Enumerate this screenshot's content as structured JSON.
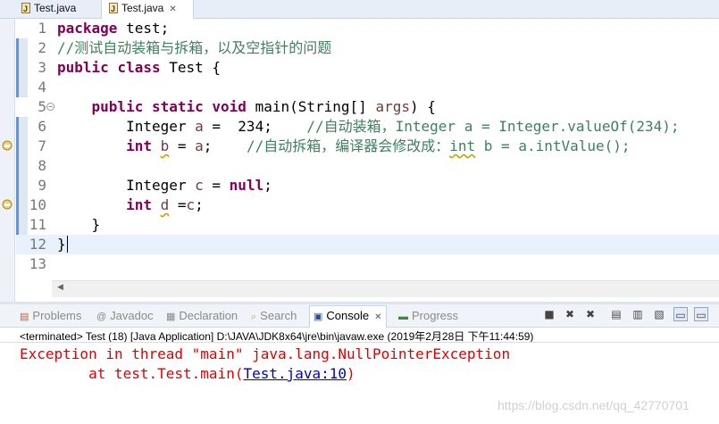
{
  "editor": {
    "tabs": [
      {
        "label": "Test.java",
        "active": false,
        "icon": "java-file-icon"
      },
      {
        "label": "Test.java",
        "active": true,
        "icon": "java-file-icon",
        "close": "✕"
      }
    ],
    "lines": [
      {
        "num": "1",
        "tokens": [
          {
            "t": "package",
            "c": "kw"
          },
          {
            "t": " test;"
          }
        ]
      },
      {
        "num": "2",
        "tokens": [
          {
            "t": "//测试自动装箱与拆箱，以及空指针的问题",
            "c": "cm"
          }
        ]
      },
      {
        "num": "3",
        "tokens": [
          {
            "t": "public",
            "c": "kw"
          },
          {
            "t": " "
          },
          {
            "t": "class",
            "c": "kw"
          },
          {
            "t": " Test "
          },
          {
            "t": "{"
          }
        ]
      },
      {
        "num": "4",
        "tokens": []
      },
      {
        "num": "5",
        "tokens": [
          {
            "t": "    "
          },
          {
            "t": "public",
            "c": "kw"
          },
          {
            "t": " "
          },
          {
            "t": "static",
            "c": "kw"
          },
          {
            "t": " "
          },
          {
            "t": "void",
            "c": "kw"
          },
          {
            "t": " main(String[] "
          },
          {
            "t": "args",
            "c": "var"
          },
          {
            "t": ") {"
          }
        ]
      },
      {
        "num": "6",
        "tokens": [
          {
            "t": "        Integer "
          },
          {
            "t": "a",
            "c": "var"
          },
          {
            "t": " =  234;    "
          },
          {
            "t": "//自动装箱，Integer a = Integer.valueOf(234);",
            "c": "cm"
          }
        ]
      },
      {
        "num": "7",
        "tokens": [
          {
            "t": "        "
          },
          {
            "t": "int",
            "c": "kw"
          },
          {
            "t": " "
          },
          {
            "t": "b",
            "c": "var sq"
          },
          {
            "t": " = "
          },
          {
            "t": "a",
            "c": "var"
          },
          {
            "t": ";    "
          },
          {
            "t": "//自动拆箱，编译器会修改成：",
            "c": "cm"
          },
          {
            "t": "int",
            "c": "cm sq"
          },
          {
            "t": " b = a.intValue();",
            "c": "cm"
          }
        ]
      },
      {
        "num": "8",
        "tokens": []
      },
      {
        "num": "9",
        "tokens": [
          {
            "t": "        Integer "
          },
          {
            "t": "c",
            "c": "var"
          },
          {
            "t": " = "
          },
          {
            "t": "null",
            "c": "kw"
          },
          {
            "t": ";"
          }
        ]
      },
      {
        "num": "10",
        "tokens": [
          {
            "t": "        "
          },
          {
            "t": "int",
            "c": "kw"
          },
          {
            "t": " "
          },
          {
            "t": "d",
            "c": "var sq"
          },
          {
            "t": " ="
          },
          {
            "t": "c",
            "c": "var"
          },
          {
            "t": ";"
          }
        ]
      },
      {
        "num": "11",
        "tokens": [
          {
            "t": "    }"
          }
        ]
      },
      {
        "num": "12",
        "tokens": [
          {
            "t": "}"
          }
        ]
      },
      {
        "num": "13",
        "tokens": []
      }
    ]
  },
  "panel": {
    "tabs": {
      "problems": "Problems",
      "javadoc": "Javadoc",
      "declaration": "Declaration",
      "search": "Search",
      "console": "Console",
      "progress": "Progress"
    },
    "console_close": "✕",
    "status": "<terminated> Test (18) [Java Application] D:\\JAVA\\JDK8x64\\jre\\bin\\javaw.exe (2019年2月28日 下午11:44:59)",
    "output": {
      "line1": "Exception in thread \"main\" java.lang.NullPointerException",
      "line2_prefix": "        at test.Test.main(",
      "line2_link": "Test.java:10",
      "line2_suffix": ")"
    }
  },
  "watermark": "https://blog.csdn.net/qq_42770701",
  "colors": {
    "keyword": "#7f0055",
    "comment": "#3f7f5f",
    "variable": "#6a3e3e",
    "error": "#e00000",
    "link": "#0000c0"
  }
}
